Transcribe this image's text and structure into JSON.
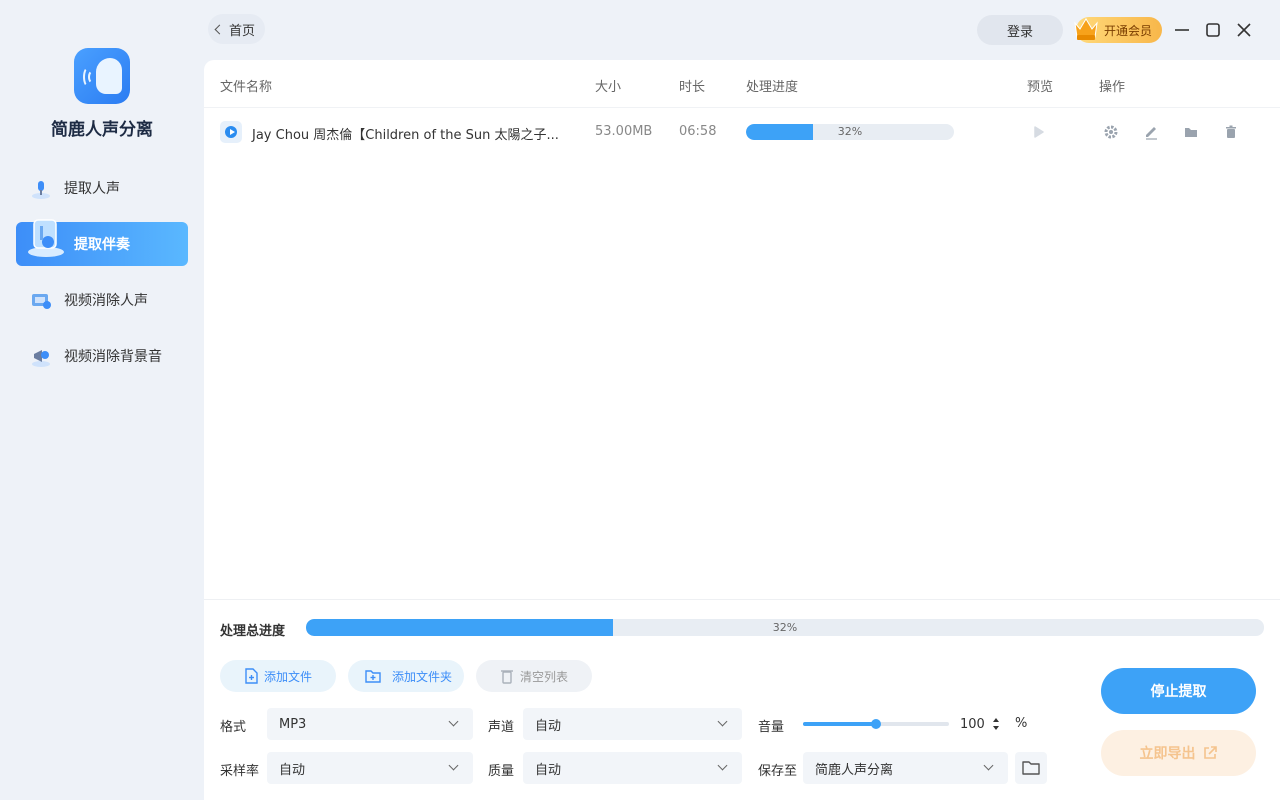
{
  "app": {
    "name": "简鹿人声分离"
  },
  "sidebar": {
    "items": [
      {
        "label": "提取人声",
        "icon": "mic-person-icon",
        "active": false
      },
      {
        "label": "提取伴奏",
        "icon": "instrumental-icon",
        "active": true
      },
      {
        "label": "视频消除人声",
        "icon": "video-vocal-remove-icon",
        "active": false
      },
      {
        "label": "视频消除背景音",
        "icon": "video-bg-remove-icon",
        "active": false
      }
    ]
  },
  "topbar": {
    "home_label": "首页",
    "login_label": "登录",
    "vip_label": "开通会员",
    "window_controls": [
      "minimize-icon",
      "maximize-icon",
      "close-icon"
    ]
  },
  "table": {
    "columns": [
      "文件名称",
      "大小",
      "时长",
      "处理进度",
      "预览",
      "操作"
    ],
    "rows": [
      {
        "name": "Jay Chou 周杰倫【Children of the Sun 太陽之子...",
        "size": "53.00MB",
        "duration": "06:58",
        "progress": 0.32,
        "progress_text": "32%",
        "actions": [
          "settings-icon",
          "edit-icon",
          "folder-icon",
          "trash-icon"
        ]
      }
    ]
  },
  "total": {
    "label": "处理总进度",
    "progress": 0.32,
    "progress_text": "32%"
  },
  "buttons": {
    "add_file": "添加文件",
    "add_folder": "添加文件夹",
    "clear_list": "清空列表",
    "stop": "停止提取",
    "export": "立即导出"
  },
  "settings": {
    "format_label": "格式",
    "format_value": "MP3",
    "channel_label": "声道",
    "channel_value": "自动",
    "volume_label": "音量",
    "volume_value": "100",
    "volume_unit": "%",
    "volume_level": 0.5,
    "samplerate_label": "采样率",
    "samplerate_value": "自动",
    "quality_label": "质量",
    "quality_value": "自动",
    "saveto_label": "保存至",
    "saveto_value": "简鹿人声分离"
  },
  "colors": {
    "accent": "#3da2f7",
    "vip": "#f8b74a",
    "export_disabled": "#fdf0e2"
  }
}
